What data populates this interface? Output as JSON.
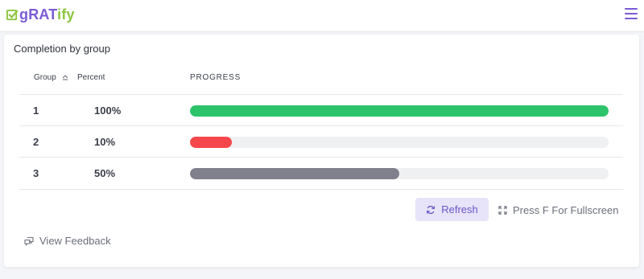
{
  "app": {
    "logo": {
      "part1": "g",
      "part2": "RAT",
      "part3": "ify"
    },
    "menu_icon": "hamburger-menu-icon"
  },
  "panel": {
    "title": "Completion by group",
    "columns": {
      "group": "Group",
      "percent": "Percent",
      "progress": "PROGRESS"
    },
    "rows": [
      {
        "group": "1",
        "percent_label": "100%",
        "progress": 1.0,
        "color": "#2cc36b"
      },
      {
        "group": "2",
        "percent_label": "10%",
        "progress": 0.1,
        "color": "#f5474b"
      },
      {
        "group": "3",
        "percent_label": "50%",
        "progress": 0.5,
        "color": "#80808c"
      }
    ],
    "refresh_label": "Refresh",
    "fullscreen_label": "Press F For Fullscreen",
    "feedback_label": "View Feedback"
  },
  "colors": {
    "accent": "#7a5bd6",
    "logo_green": "#8cc63f",
    "track": "#eff0f2"
  }
}
